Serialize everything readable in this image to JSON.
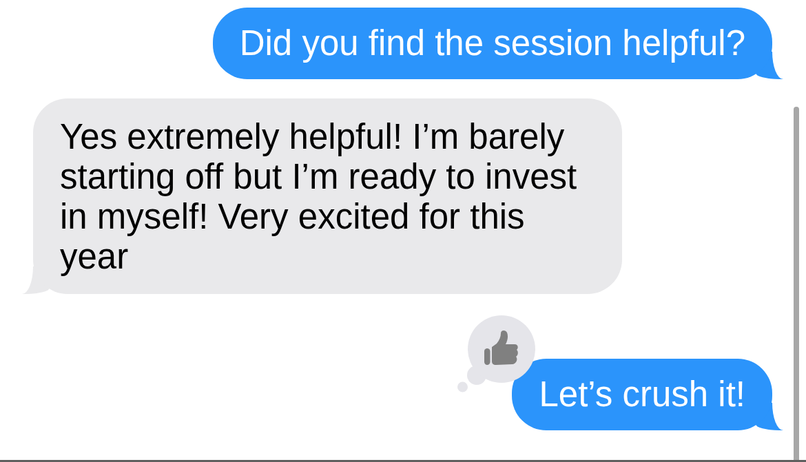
{
  "messages": [
    {
      "kind": "outgoing",
      "text": "Did you find the session helpful?",
      "liked": false
    },
    {
      "kind": "incoming",
      "text": "Yes extremely helpful! I’m barely starting off but I’m ready to invest in myself! Very excited for this year",
      "liked": false
    },
    {
      "kind": "outgoing",
      "text": "Let’s crush it!",
      "liked": true
    }
  ]
}
